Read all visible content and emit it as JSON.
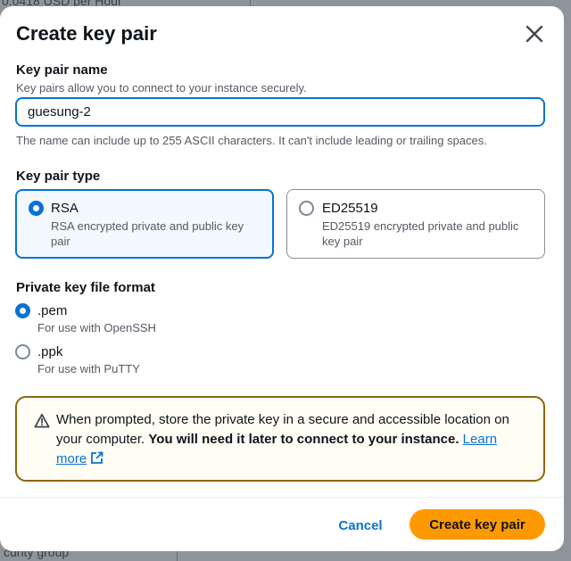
{
  "background": {
    "top_text": "0.0418 USD per Hour",
    "bottom_text": "curity group"
  },
  "modal": {
    "title": "Create key pair",
    "key_pair_name": {
      "label": "Key pair name",
      "description": "Key pairs allow you to connect to your instance securely.",
      "value": "guesung-2",
      "constraint": "The name can include up to 255 ASCII characters. It can't include leading or trailing spaces."
    },
    "key_pair_type": {
      "label": "Key pair type",
      "options": [
        {
          "title": "RSA",
          "description": "RSA encrypted private and public key pair",
          "selected": true
        },
        {
          "title": "ED25519",
          "description": "ED25519 encrypted private and public key pair",
          "selected": false
        }
      ]
    },
    "file_format": {
      "label": "Private key file format",
      "options": [
        {
          "title": ".pem",
          "description": "For use with OpenSSH",
          "selected": true
        },
        {
          "title": ".ppk",
          "description": "For use with PuTTY",
          "selected": false
        }
      ]
    },
    "alert": {
      "text": "When prompted, store the private key in a secure and accessible location on your computer.",
      "bold_text": "You will need it later to connect to your instance.",
      "link_text": "Learn more"
    },
    "footer": {
      "cancel_label": "Cancel",
      "create_label": "Create key pair"
    }
  },
  "colors": {
    "accent": "#0972d3",
    "primary_button": "#ff9900",
    "warning_border": "#8d6605"
  }
}
